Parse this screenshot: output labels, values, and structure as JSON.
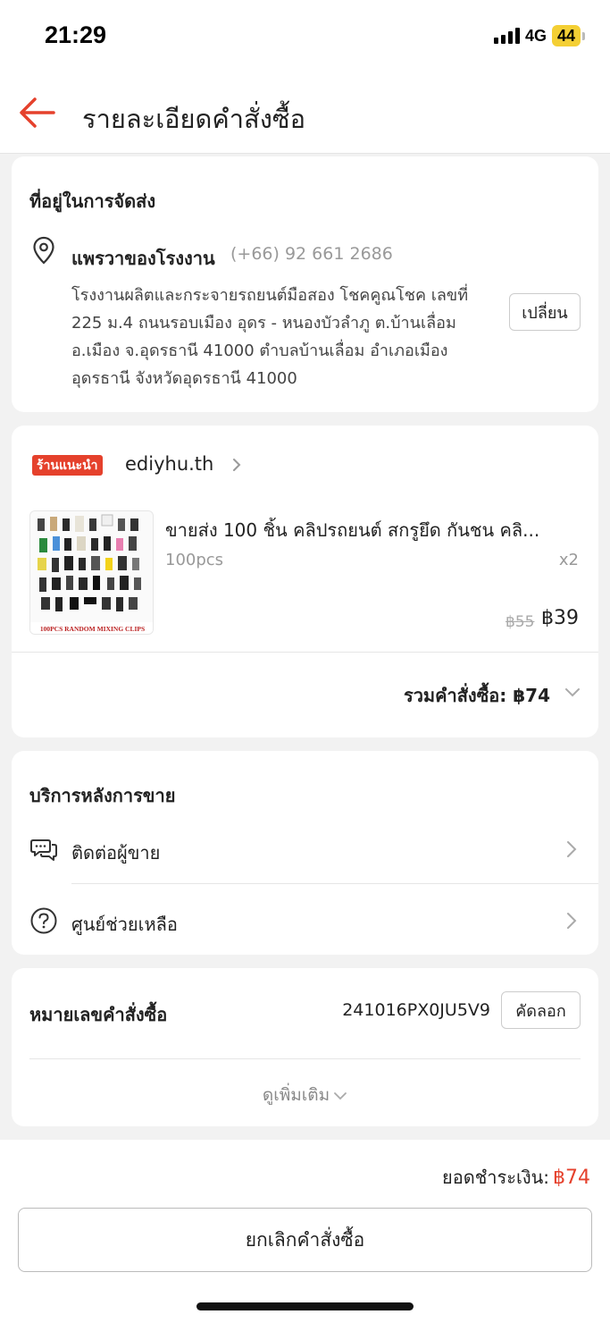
{
  "status_bar": {
    "time": "21:29",
    "network": "4G",
    "battery": "44"
  },
  "header": {
    "title": "รายละเอียดคำสั่งซื้อ"
  },
  "address": {
    "section_title": "ที่อยู่ในการจัดส่ง",
    "name": "แพรวาของโรงงาน",
    "phone": "(+66) 92 661 2686",
    "lines": [
      "โรงงานผลิตและกระจายรถยนต์มือสอง โชคคูณโชค เลขที่",
      "225 ม.4 ถนนรอบเมือง อุดร - หนองบัวลำภู  ต.บ้านเลื่อม",
      "อ.เมือง จ.อุดรธานี 41000 ตำบลบ้านเลื่อม อำเภอเมือง",
      "อุดรธานี จังหวัดอุดรธานี 41000"
    ],
    "change_label": "เปลี่ยน"
  },
  "shop": {
    "badge": "ร้านแนะนำ",
    "name": "ediyhu.th",
    "product": {
      "title": "ขายส่ง 100 ชิ้น คลิปรถยนต์ สกรูยึด กันชน คลิ...",
      "variant": "100pcs",
      "quantity": "x2",
      "original_price": "฿55",
      "price": "฿39",
      "image_caption": "100PCS RANDOM MIXING CLIPS"
    },
    "order_total": "รวมคำสั่งซื้อ: ฿74"
  },
  "service": {
    "section_title": "บริการหลังการขาย",
    "items": [
      {
        "label": "ติดต่อผู้ขาย",
        "icon": "chat-icon"
      },
      {
        "label": "ศูนย์ช่วยเหลือ",
        "icon": "help-icon"
      }
    ]
  },
  "order": {
    "label": "หมายเลขคำสั่งซื้อ",
    "id": "241016PX0JU5V9",
    "copy_label": "คัดลอก",
    "see_more": "ดูเพิ่มเติม"
  },
  "footer": {
    "payment_label": "ยอดชำระเงิน:",
    "payment_amount": "฿74",
    "cancel_label": "ยกเลิกคำสั่งซื้อ"
  },
  "colors": {
    "accent": "#e5412c",
    "badge": "#e5412c",
    "background": "#f2f2f2"
  }
}
